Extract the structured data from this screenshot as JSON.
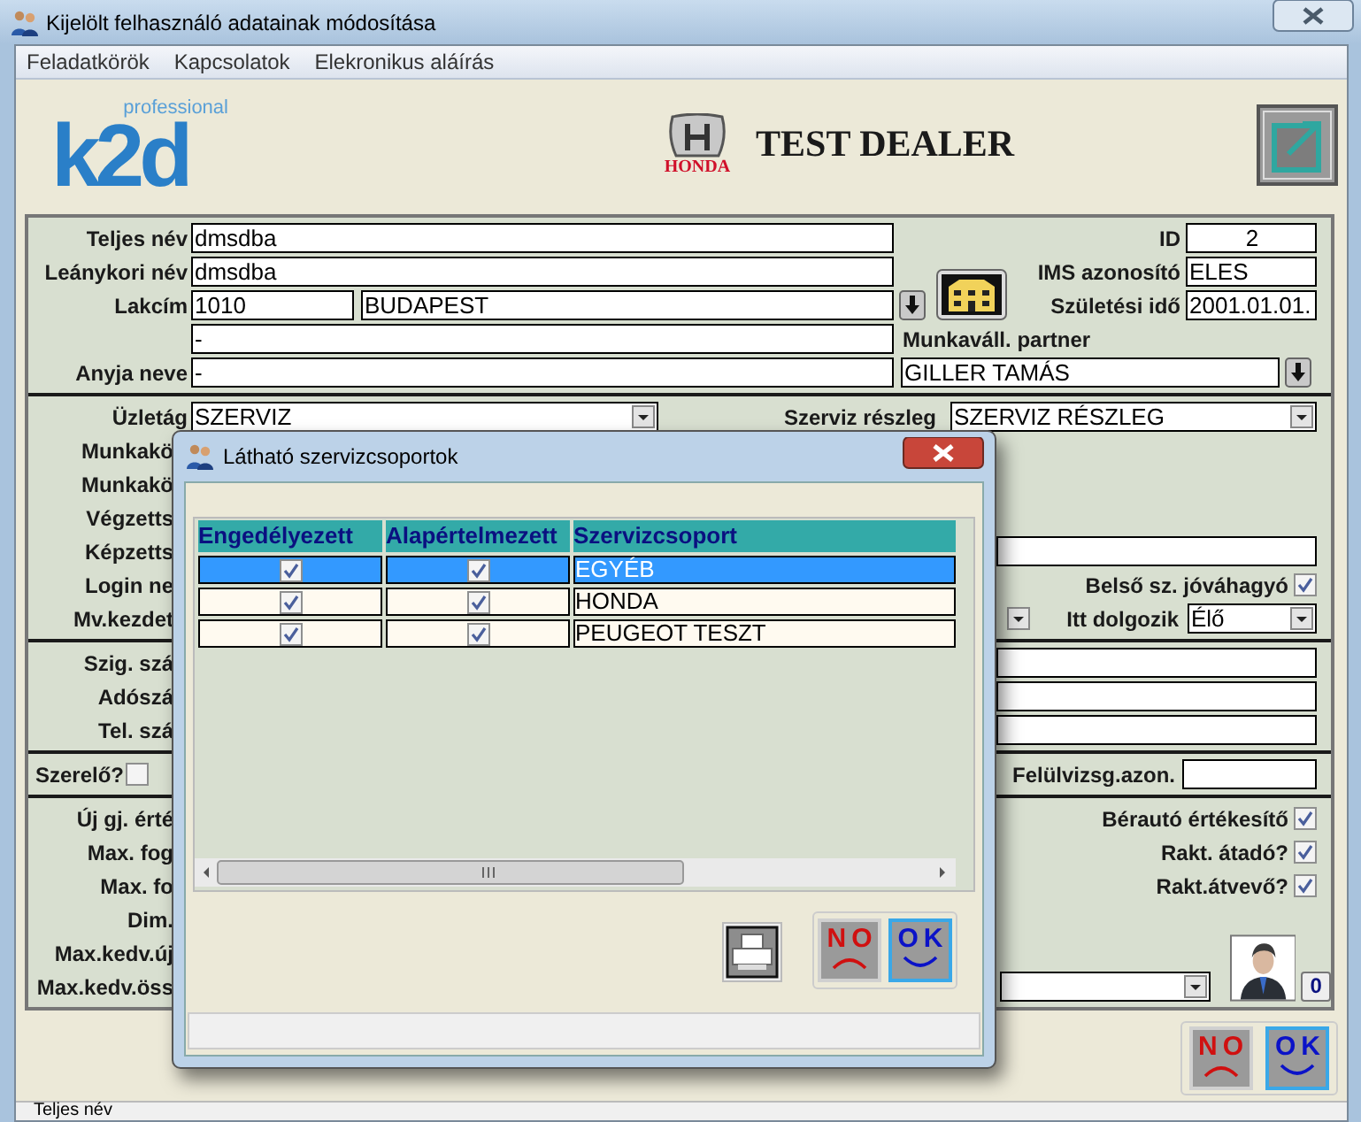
{
  "window": {
    "title": "Kijelölt felhasználó adatainak módosítása"
  },
  "menu": [
    "Feladatkörök",
    "Kapcsolatok",
    "Elekronikus aláírás"
  ],
  "header": {
    "logo_tagline": "professional",
    "logo_name": "k2d",
    "brand": "HONDA",
    "dealer": "TEST DEALER"
  },
  "form": {
    "full_name": {
      "label": "Teljes név",
      "value": "dmsdba"
    },
    "maiden_name": {
      "label": "Leánykori név",
      "value": "dmsdba"
    },
    "address": {
      "label": "Lakcím",
      "zip": "1010",
      "city": "BUDAPEST",
      "street": "-"
    },
    "mother_name": {
      "label": "Anyja neve",
      "value": "-"
    },
    "id": {
      "label": "ID",
      "value": "2"
    },
    "ims": {
      "label": "IMS azonosító",
      "value": "ELES"
    },
    "birth": {
      "label": "Születési idő",
      "value": "2001.01.01."
    },
    "partner": {
      "label": "Munkaváll. partner",
      "value": "GILLER TAMÁS"
    },
    "branch": {
      "label": "Üzletág",
      "value": "SZERVIZ"
    },
    "department": {
      "label": "Szerviz részleg",
      "value": "SZERVIZ RÉSZLEG"
    },
    "covered_labels_1": [
      "Munkakö",
      "Munkakö",
      "Végzetts",
      "Képzetts",
      "Login ne",
      "Mv.kezdet"
    ],
    "internal_approver": {
      "label": "Belső sz. jóváhagyó",
      "checked": true
    },
    "works_here": {
      "label": "Itt dolgozik",
      "value": "Élő"
    },
    "covered_labels_2": [
      "Szig. szá",
      "Adószá",
      "Tel. szá"
    ],
    "mechanic": {
      "label": "Szerelő?",
      "checked": false
    },
    "inspection": {
      "label": "Felülvizsg.azon."
    },
    "covered_labels_3": [
      "Új gj. érté",
      "Max. fog",
      "Max. fo",
      "Dim.",
      "Max.kedv.új",
      "Max.kedv.öss"
    ],
    "right_checks": [
      {
        "label": "Bérautó értékesítő",
        "checked": true
      },
      {
        "label": "Rakt. átadó?",
        "checked": true
      },
      {
        "label": "Rakt.átvevő?",
        "checked": true
      }
    ],
    "photo_count": "0"
  },
  "buttons": [
    {
      "kind": "no",
      "label": "NO"
    },
    {
      "kind": "ok",
      "label": "OK"
    }
  ],
  "status_bar": {
    "text": "Teljes név"
  },
  "dialog": {
    "title": "Látható szervizcsoportok",
    "columns": [
      "Engedélyezett",
      "Alapértelmezett",
      "Szervizcsoport"
    ],
    "rows": [
      {
        "enabled": true,
        "default": true,
        "group": "EGYÉB",
        "selected": true
      },
      {
        "enabled": true,
        "default": true,
        "group": "HONDA",
        "selected": false
      },
      {
        "enabled": true,
        "default": true,
        "group": "PEUGEOT TESZT",
        "selected": false
      }
    ],
    "buttons": [
      {
        "kind": "no",
        "label": "NO"
      },
      {
        "kind": "ok",
        "label": "OK"
      }
    ]
  }
}
